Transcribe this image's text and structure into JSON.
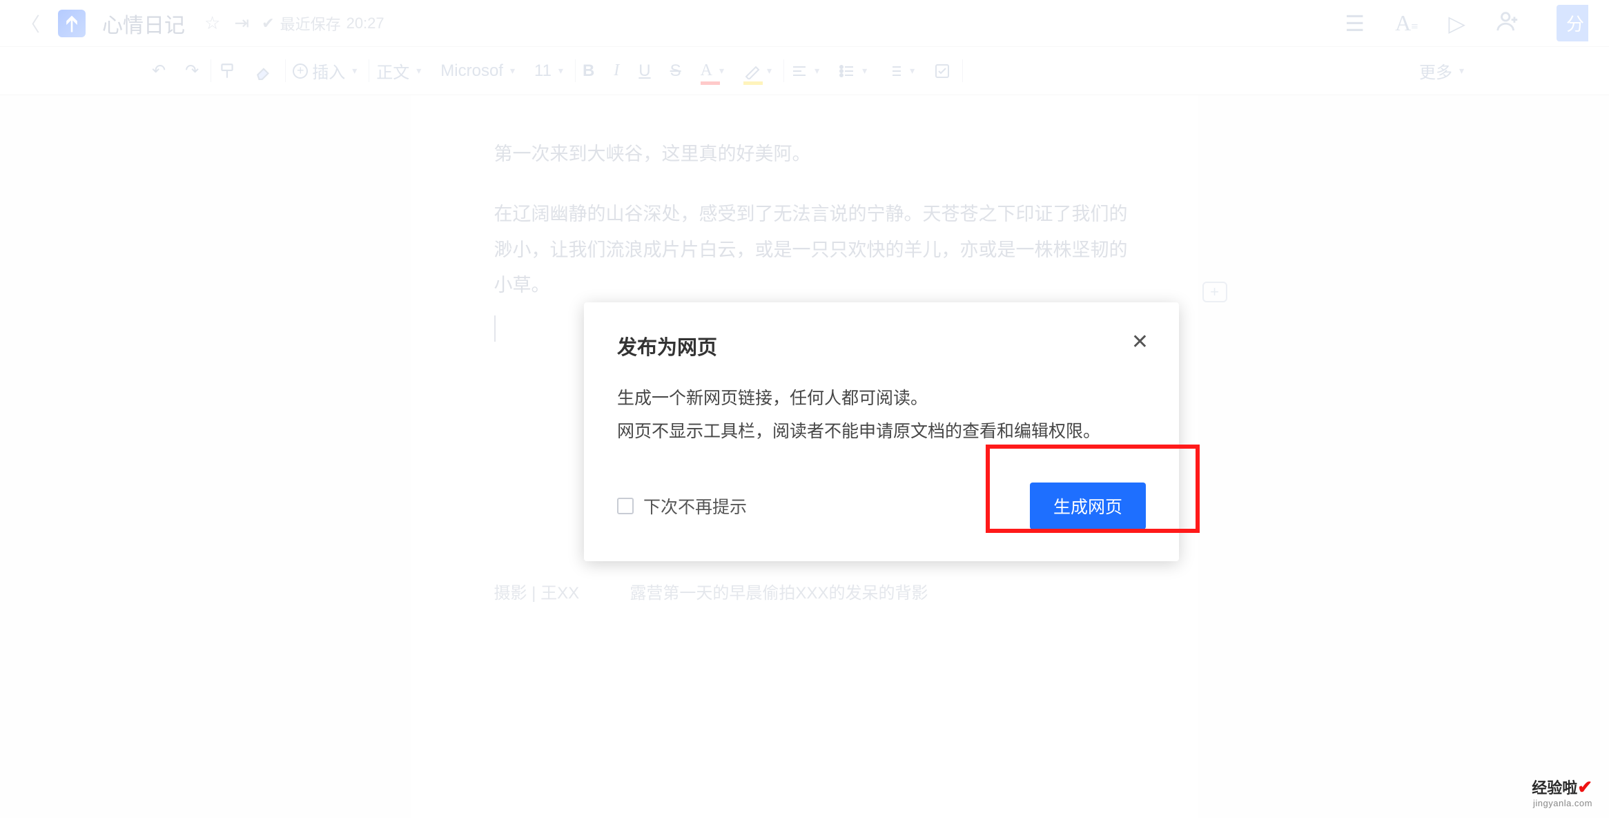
{
  "header": {
    "doc_title": "心情日记",
    "save_prefix": "最近保存",
    "save_time": "20:27",
    "share_label": "分"
  },
  "toolbar": {
    "insert_label": "插入",
    "style_label": "正文",
    "font_family": "Microsof",
    "font_size": "11",
    "more_label": "更多"
  },
  "document": {
    "p1": "第一次来到大峡谷，这里真的好美阿。",
    "p2": "在辽阔幽静的山谷深处，感受到了无法言说的宁静。天苍苍之下印证了我们的渺小，让我们流浪成片片白云，或是一只只欢快的羊儿，亦或是一株株坚韧的小草。",
    "caption_left": "摄影 | 王XX",
    "caption_right": "露营第一天的早晨偷拍XXX的发呆的背影"
  },
  "dialog": {
    "title": "发布为网页",
    "line1": "生成一个新网页链接，任何人都可阅读。",
    "line2": "网页不显示工具栏，阅读者不能申请原文档的查看和编辑权限。",
    "dont_show": "下次不再提示",
    "confirm": "生成网页"
  },
  "watermark": {
    "text": "经验啦",
    "url": "jingyanla.com"
  }
}
